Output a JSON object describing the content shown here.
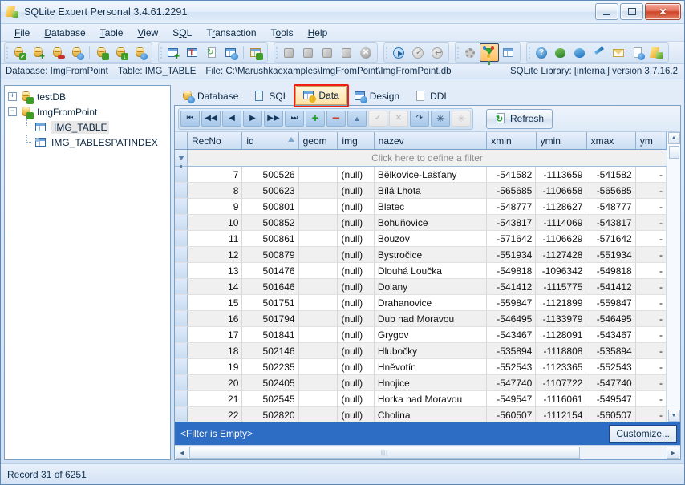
{
  "window": {
    "title": "SQLite Expert Personal 3.4.61.2291",
    "app_icon": "sqlite-expert-logo-icon",
    "buttons": {
      "minimize": "minimize-icon",
      "maximize": "maximize-icon",
      "close": "close-icon"
    }
  },
  "menu": [
    {
      "label": "File",
      "accel": "F"
    },
    {
      "label": "Database",
      "accel": "D"
    },
    {
      "label": "Table",
      "accel": "T"
    },
    {
      "label": "View",
      "accel": "V"
    },
    {
      "label": "SQL",
      "accel": "Q"
    },
    {
      "label": "Transaction",
      "accel": "r"
    },
    {
      "label": "Tools",
      "accel": "o"
    },
    {
      "label": "Help",
      "accel": "H"
    }
  ],
  "toolbar": {
    "groups": [
      {
        "name": "database-group",
        "buttons": [
          {
            "icon": "database-open-icon"
          },
          {
            "icon": "database-new-icon"
          },
          {
            "icon": "database-close-icon"
          },
          {
            "icon": "database-properties-icon"
          },
          {
            "sep": true
          },
          {
            "icon": "database-attach-icon"
          },
          {
            "icon": "database-detach-icon"
          },
          {
            "icon": "database-backup-icon"
          }
        ]
      },
      {
        "name": "table-group",
        "buttons": [
          {
            "icon": "table-new-icon"
          },
          {
            "icon": "table-rename-icon"
          },
          {
            "icon": "table-refresh-icon"
          },
          {
            "icon": "table-design-icon"
          },
          {
            "sep": true
          },
          {
            "icon": "table-relations-icon"
          }
        ]
      },
      {
        "name": "import-export-group",
        "buttons": [
          {
            "icon": "import-icon"
          },
          {
            "icon": "export-icon"
          },
          {
            "icon": "import-wizard-icon"
          },
          {
            "icon": "export-wizard-icon"
          },
          {
            "icon": "cancel-icon"
          }
        ]
      },
      {
        "name": "execute-group",
        "buttons": [
          {
            "icon": "execute-icon"
          },
          {
            "icon": "commit-icon"
          },
          {
            "icon": "rollback-icon"
          }
        ]
      },
      {
        "name": "options-group",
        "buttons": [
          {
            "icon": "gear-icon"
          },
          {
            "icon": "filter-funnel-icon",
            "active": true
          },
          {
            "icon": "grid-layout-icon"
          }
        ]
      },
      {
        "name": "help-group",
        "buttons": [
          {
            "icon": "help-question-icon"
          },
          {
            "icon": "home-globe-icon"
          },
          {
            "icon": "web-help-icon"
          },
          {
            "icon": "pen-icon"
          },
          {
            "icon": "email-icon"
          },
          {
            "icon": "document-help-icon"
          },
          {
            "icon": "about-logo-icon"
          }
        ]
      }
    ]
  },
  "infobar": {
    "database_label": "Database: ImgFromPoint",
    "table_label": "Table: IMG_TABLE",
    "file_label": "File: C:\\Marushkaexamples\\ImgFromPoint\\ImgFromPoint.db",
    "library_label": "SQLite Library: [internal] version 3.7.16.2"
  },
  "tree": {
    "nodes": [
      {
        "label": "testDB",
        "icon": "database-icon",
        "expander": "+",
        "level": 0,
        "expanded": false
      },
      {
        "label": "ImgFromPoint",
        "icon": "database-icon",
        "expander": "-",
        "level": 0,
        "expanded": true
      },
      {
        "label": "IMG_TABLE",
        "icon": "table-icon",
        "level": 1,
        "selected": true
      },
      {
        "label": "IMG_TABLESPATINDEX",
        "icon": "table-index-icon",
        "level": 1,
        "selected": false
      }
    ]
  },
  "tabs": [
    {
      "label": "Database",
      "icon": "database-tab-icon",
      "selected": false
    },
    {
      "label": "SQL",
      "icon": "sql-tab-icon",
      "selected": false
    },
    {
      "label": "Data",
      "icon": "data-tab-icon",
      "selected": true,
      "highlighted": true
    },
    {
      "label": "Design",
      "icon": "design-tab-icon",
      "selected": false
    },
    {
      "label": "DDL",
      "icon": "ddl-tab-icon",
      "selected": false
    }
  ],
  "navbar": {
    "buttons": [
      {
        "name": "first-record-button",
        "glyph": "|◀◀",
        "disabled": false
      },
      {
        "name": "prior-page-button",
        "glyph": "◀◀",
        "disabled": false
      },
      {
        "name": "prior-record-button",
        "glyph": "◀",
        "disabled": false
      },
      {
        "name": "next-record-button",
        "glyph": "▶",
        "disabled": false
      },
      {
        "name": "next-page-button",
        "glyph": "▶▶",
        "disabled": false
      },
      {
        "name": "last-record-button",
        "glyph": "▶▶|",
        "disabled": false
      },
      {
        "name": "insert-record-button",
        "glyph": "+",
        "disabled": false
      },
      {
        "name": "delete-record-button",
        "glyph": "−",
        "disabled": false
      },
      {
        "name": "edit-record-button",
        "glyph": "▲",
        "disabled": false
      },
      {
        "name": "post-edit-button",
        "glyph": "✓",
        "disabled": true
      },
      {
        "name": "cancel-edit-button",
        "glyph": "✕",
        "disabled": true
      },
      {
        "name": "refresh-record-button",
        "glyph": "↷",
        "disabled": false
      },
      {
        "name": "clear-value-button",
        "glyph": "✳",
        "disabled": false
      },
      {
        "name": "set-null-button",
        "glyph": "✳",
        "disabled": true
      }
    ],
    "refresh_label": "Refresh",
    "refresh_icon": "refresh-icon"
  },
  "grid": {
    "columns": [
      {
        "key": "recno",
        "label": "RecNo",
        "align": "right",
        "sorted": false
      },
      {
        "key": "id",
        "label": "id",
        "align": "right",
        "sorted": true,
        "sort_dir": "asc"
      },
      {
        "key": "geom",
        "label": "geom",
        "align": "left",
        "sorted": false
      },
      {
        "key": "img",
        "label": "img",
        "align": "left",
        "sorted": false
      },
      {
        "key": "nazev",
        "label": "nazev",
        "align": "left",
        "sorted": false
      },
      {
        "key": "xmin",
        "label": "xmin",
        "align": "right",
        "sorted": false
      },
      {
        "key": "ymin",
        "label": "ymin",
        "align": "right",
        "sorted": false
      },
      {
        "key": "xmax",
        "label": "xmax",
        "align": "right",
        "sorted": false
      },
      {
        "key": "ymax",
        "label": "ym",
        "align": "right",
        "sorted": false
      }
    ],
    "filter_prompt": "Click here to define a filter",
    "rows": [
      {
        "recno": "7",
        "id": "500526",
        "geom": "",
        "img": "(null)",
        "nazev": "Bělkovice-Lašťany",
        "xmin": "-541582",
        "ymin": "-1113659",
        "xmax": "-541582",
        "ymax": "-"
      },
      {
        "recno": "8",
        "id": "500623",
        "geom": "",
        "img": "(null)",
        "nazev": "Bílá Lhota",
        "xmin": "-565685",
        "ymin": "-1106658",
        "xmax": "-565685",
        "ymax": "-"
      },
      {
        "recno": "9",
        "id": "500801",
        "geom": "",
        "img": "(null)",
        "nazev": "Blatec",
        "xmin": "-548777",
        "ymin": "-1128627",
        "xmax": "-548777",
        "ymax": "-"
      },
      {
        "recno": "10",
        "id": "500852",
        "geom": "",
        "img": "(null)",
        "nazev": "Bohuňovice",
        "xmin": "-543817",
        "ymin": "-1114069",
        "xmax": "-543817",
        "ymax": "-"
      },
      {
        "recno": "11",
        "id": "500861",
        "geom": "",
        "img": "(null)",
        "nazev": "Bouzov",
        "xmin": "-571642",
        "ymin": "-1106629",
        "xmax": "-571642",
        "ymax": "-"
      },
      {
        "recno": "12",
        "id": "500879",
        "geom": "",
        "img": "(null)",
        "nazev": "Bystročice",
        "xmin": "-551934",
        "ymin": "-1127428",
        "xmax": "-551934",
        "ymax": "-"
      },
      {
        "recno": "13",
        "id": "501476",
        "geom": "",
        "img": "(null)",
        "nazev": "Dlouhá Loučka",
        "xmin": "-549818",
        "ymin": "-1096342",
        "xmax": "-549818",
        "ymax": "-"
      },
      {
        "recno": "14",
        "id": "501646",
        "geom": "",
        "img": "(null)",
        "nazev": "Dolany",
        "xmin": "-541412",
        "ymin": "-1115775",
        "xmax": "-541412",
        "ymax": "-"
      },
      {
        "recno": "15",
        "id": "501751",
        "geom": "",
        "img": "(null)",
        "nazev": "Drahanovice",
        "xmin": "-559847",
        "ymin": "-1121899",
        "xmax": "-559847",
        "ymax": "-"
      },
      {
        "recno": "16",
        "id": "501794",
        "geom": "",
        "img": "(null)",
        "nazev": "Dub nad Moravou",
        "xmin": "-546495",
        "ymin": "-1133979",
        "xmax": "-546495",
        "ymax": "-"
      },
      {
        "recno": "17",
        "id": "501841",
        "geom": "",
        "img": "(null)",
        "nazev": "Grygov",
        "xmin": "-543467",
        "ymin": "-1128091",
        "xmax": "-543467",
        "ymax": "-"
      },
      {
        "recno": "18",
        "id": "502146",
        "geom": "",
        "img": "(null)",
        "nazev": "Hlubočky",
        "xmin": "-535894",
        "ymin": "-1118808",
        "xmax": "-535894",
        "ymax": "-"
      },
      {
        "recno": "19",
        "id": "502235",
        "geom": "",
        "img": "(null)",
        "nazev": "Hněvotín",
        "xmin": "-552543",
        "ymin": "-1123365",
        "xmax": "-552543",
        "ymax": "-"
      },
      {
        "recno": "20",
        "id": "502405",
        "geom": "",
        "img": "(null)",
        "nazev": "Hnojice",
        "xmin": "-547740",
        "ymin": "-1107722",
        "xmax": "-547740",
        "ymax": "-"
      },
      {
        "recno": "21",
        "id": "502545",
        "geom": "",
        "img": "(null)",
        "nazev": "Horka nad Moravou",
        "xmin": "-549547",
        "ymin": "-1116061",
        "xmax": "-549547",
        "ymax": "-"
      },
      {
        "recno": "22",
        "id": "502820",
        "geom": "",
        "img": "(null)",
        "nazev": "Cholina",
        "xmin": "-560507",
        "ymin": "-1112154",
        "xmax": "-560507",
        "ymax": "-"
      }
    ]
  },
  "filterbar": {
    "status": "<Filter is Empty>",
    "customize_label": "Customize..."
  },
  "statusbar": {
    "record_label": "Record 31 of 6251"
  },
  "colors": {
    "accent_blue": "#2d6dc4",
    "highlight_red": "#f01f0f",
    "tab_selected": "#ffe2a6",
    "window_bg": "#d6e3f5"
  }
}
